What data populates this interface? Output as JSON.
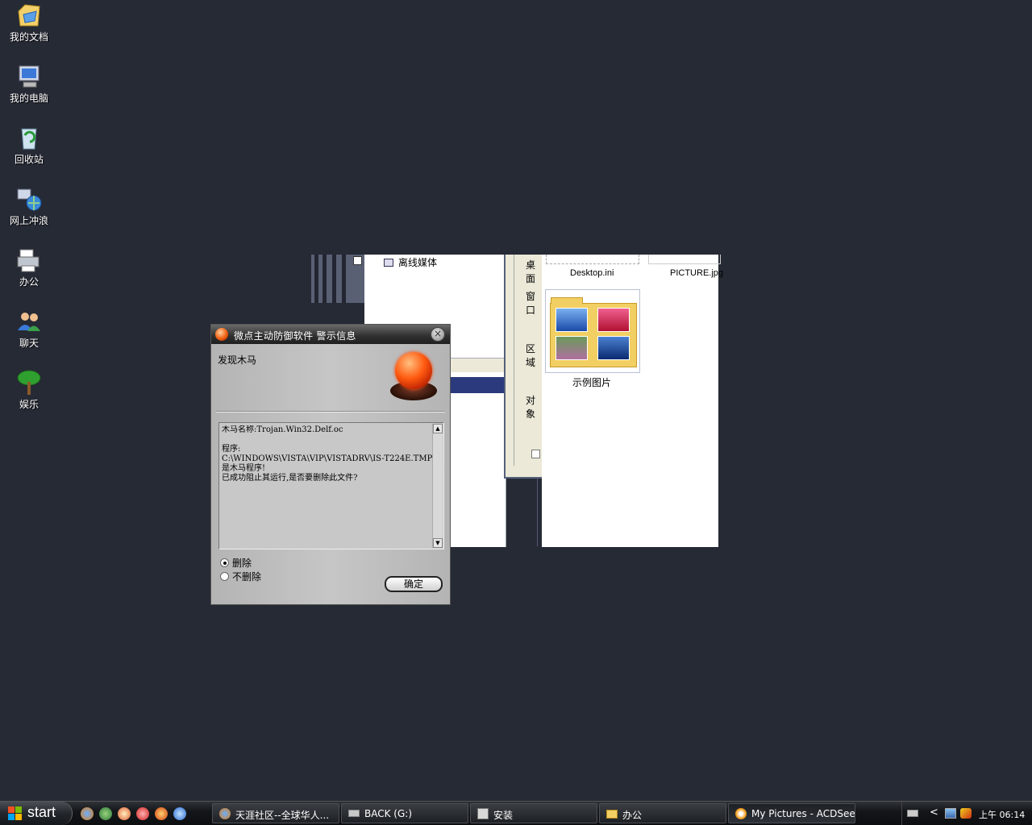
{
  "desktop": {
    "icons": [
      {
        "label": "我的文档"
      },
      {
        "label": "我的电脑"
      },
      {
        "label": "回收站"
      },
      {
        "label": "网上冲浪"
      },
      {
        "label": "办公"
      },
      {
        "label": "聊天"
      },
      {
        "label": "娱乐"
      }
    ]
  },
  "explorer": {
    "tree_item": "离线媒体",
    "side_labels": [
      "桌面",
      "窗口",
      "区域",
      "对象"
    ],
    "files": {
      "desktop_ini": "Desktop.ini",
      "picture_jpg": "PICTURE.jpg",
      "sample_folder": "示例图片"
    }
  },
  "alert": {
    "title": "微点主动防御软件  警示信息",
    "close_glyph": "×",
    "headline": "发现木马",
    "message": "木马名称:Trojan.Win32.Delf.oc\n\n程序:\nC:\\WINDOWS\\VISTA\\VIP\\VISTADRV\\IS-T224E.TMP\n是木马程序!\n已成功阻止其运行,是否要删除此文件?",
    "options": [
      {
        "label": "删除",
        "selected": true
      },
      {
        "label": "不删除",
        "selected": false
      }
    ],
    "ok_label": "确定"
  },
  "taskbar": {
    "start_label": "start",
    "tasks": [
      {
        "label": "天涯社区--全球华人..."
      },
      {
        "label": "BACK (G:)"
      },
      {
        "label": "安装"
      },
      {
        "label": "办公"
      },
      {
        "label": "My Pictures - ACDSee ..."
      }
    ],
    "tray_arrow": "<",
    "clock": "上午 06:14"
  },
  "colors": {
    "desktop_bg": "#262a35",
    "alert_siren": "#ff5a10"
  }
}
